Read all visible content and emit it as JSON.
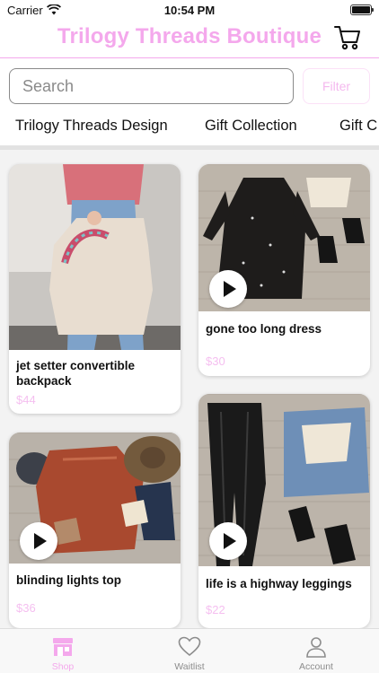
{
  "status_bar": {
    "carrier": "Carrier",
    "time": "10:54 PM"
  },
  "header": {
    "title": "Trilogy Threads Boutique",
    "cart_icon": "cart-icon"
  },
  "search": {
    "placeholder": "Search",
    "filter_label": "Filter"
  },
  "categories": [
    "Trilogy Threads Design",
    "Gift Collection",
    "Gift C"
  ],
  "products": [
    {
      "title": "jet setter convertible backpack",
      "price": "$44",
      "has_video": false
    },
    {
      "title": "gone too long dress",
      "price": "$30",
      "has_video": true
    },
    {
      "title": "blinding lights top",
      "price": "$36",
      "has_video": true
    },
    {
      "title": "life is a highway leggings",
      "price": "$22",
      "has_video": true
    }
  ],
  "tabs": [
    {
      "label": "Shop",
      "icon": "store-icon",
      "active": true
    },
    {
      "label": "Waitlist",
      "icon": "heart-icon",
      "active": false
    },
    {
      "label": "Account",
      "icon": "person-icon",
      "active": false
    }
  ],
  "colors": {
    "accent_pink": "#f4a8ec",
    "price_pink": "#f5bff0",
    "grid_bg": "#f3f3f3"
  }
}
